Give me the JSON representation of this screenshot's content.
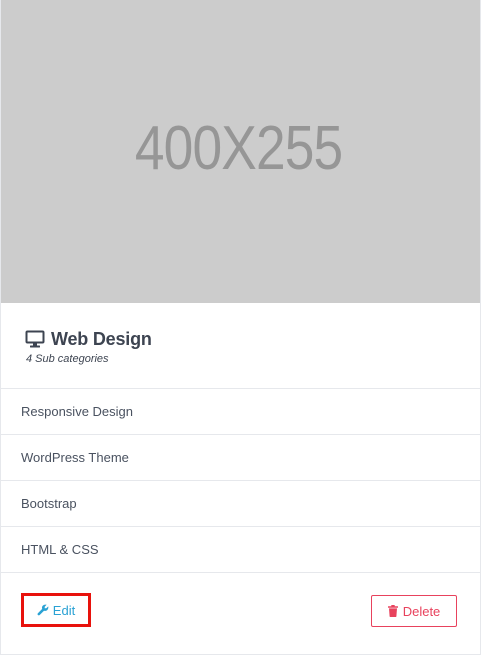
{
  "thumbnail": {
    "placeholder_text": "400X255"
  },
  "category": {
    "icon": "desktop-icon",
    "title": "Web Design",
    "subtitle": "4 Sub categories"
  },
  "subcategories": [
    {
      "label": "Responsive Design"
    },
    {
      "label": "WordPress Theme"
    },
    {
      "label": "Bootstrap"
    },
    {
      "label": "HTML & CSS"
    }
  ],
  "actions": {
    "edit": {
      "label": "Edit",
      "icon": "wrench-icon"
    },
    "delete": {
      "label": "Delete",
      "icon": "trash-icon"
    }
  },
  "colors": {
    "thumbnail_bg": "#cccccc",
    "edit_accent": "#2aa2d4",
    "edit_highlight": "#e8120c",
    "delete_accent": "#e8425d",
    "title_text": "#3d4451"
  }
}
